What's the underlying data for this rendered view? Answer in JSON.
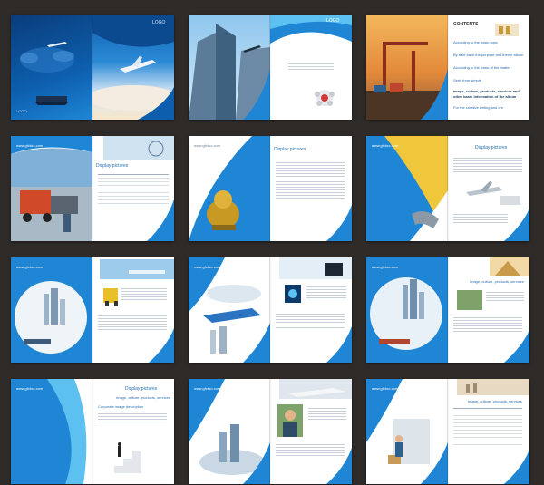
{
  "website": "www.gfctoo.com",
  "logo": "LOGO",
  "contents_title": "CONTENTS",
  "contents_lines": [
    "According to the basic topic",
    "By date back the purpose and theme album",
    "According to the basic of the matter",
    "Seek from simple",
    "Image, culture, products, services and other basic information of the album",
    "For the creative writing and cre"
  ],
  "display_pictures": "Display pictures",
  "image_culture": "Image, culture, products, services",
  "corporate_image": "Corporate image description",
  "colors": {
    "background": "#2f2b29",
    "blue_dark": "#0d5fae",
    "blue_mid": "#1f86d6",
    "blue_light": "#5cc0f0",
    "yellow": "#f0c63a"
  }
}
